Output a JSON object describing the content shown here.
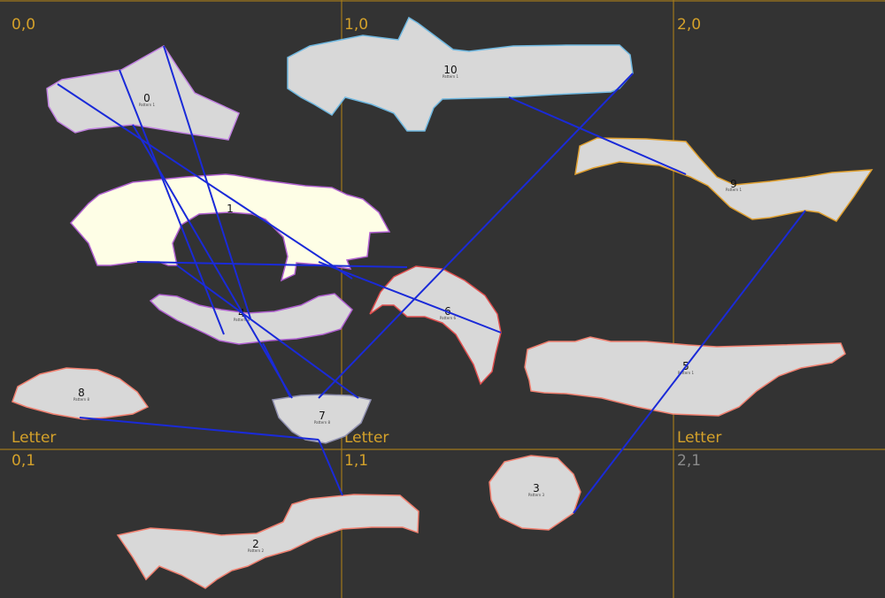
{
  "colors": {
    "background": "#333333",
    "grid": "#a0781c",
    "label": "#d4a12a",
    "label_dim": "#8a8a8a",
    "piece_fill": "#d8d8d8",
    "piece_selected_fill": "#fefee6",
    "connector": "#1a2ad8"
  },
  "cells": [
    {
      "label": "0,0",
      "dim": false
    },
    {
      "label": "1,0",
      "dim": false
    },
    {
      "label": "2,0",
      "dim": false
    },
    {
      "label": "0,1",
      "dim": false
    },
    {
      "label": "1,1",
      "dim": false
    },
    {
      "label": "2,1",
      "dim": true
    }
  ],
  "page_labels": [
    "Letter",
    "Letter",
    "Letter"
  ],
  "pieces": [
    {
      "id": "0",
      "sub": "Pattern 1",
      "selected": false
    },
    {
      "id": "10",
      "sub": "Pattern 1",
      "selected": false
    },
    {
      "id": "9",
      "sub": "Pattern 1",
      "selected": false
    },
    {
      "id": "1",
      "sub": "",
      "selected": true
    },
    {
      "id": "4",
      "sub": "Pattern 4",
      "selected": false
    },
    {
      "id": "6",
      "sub": "Pattern 6",
      "selected": false
    },
    {
      "id": "5",
      "sub": "Pattern 1",
      "selected": false
    },
    {
      "id": "8",
      "sub": "Pattern 8",
      "selected": false
    },
    {
      "id": "7",
      "sub": "Pattern 8",
      "selected": false
    },
    {
      "id": "3",
      "sub": "Pattern 3",
      "selected": false
    },
    {
      "id": "2",
      "sub": "Pattern 2",
      "selected": false
    }
  ]
}
